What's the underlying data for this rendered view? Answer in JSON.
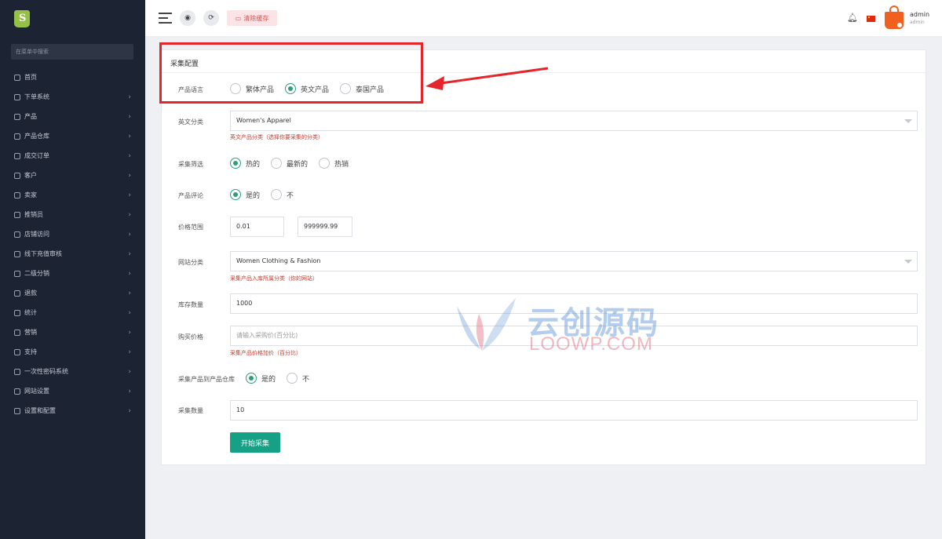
{
  "sidebar": {
    "search_placeholder": "在菜单中搜索",
    "items": [
      {
        "label": "首页",
        "icon": "home-icon",
        "has_arrow": false
      },
      {
        "label": "下单系统",
        "icon": "order-icon",
        "has_arrow": true
      },
      {
        "label": "产品",
        "icon": "cart-icon",
        "has_arrow": true
      },
      {
        "label": "产品仓库",
        "icon": "warehouse-icon",
        "has_arrow": true
      },
      {
        "label": "成交订单",
        "icon": "receipt-icon",
        "has_arrow": true
      },
      {
        "label": "客户",
        "icon": "customer-icon",
        "has_arrow": true
      },
      {
        "label": "卖家",
        "icon": "seller-icon",
        "has_arrow": true
      },
      {
        "label": "推销员",
        "icon": "salesman-icon",
        "has_arrow": true
      },
      {
        "label": "店铺访问",
        "icon": "visit-icon",
        "has_arrow": true
      },
      {
        "label": "线下充值审核",
        "icon": "recharge-icon",
        "has_arrow": true
      },
      {
        "label": "二级分销",
        "icon": "distribution-icon",
        "has_arrow": true
      },
      {
        "label": "退款",
        "icon": "refund-icon",
        "has_arrow": true
      },
      {
        "label": "统计",
        "icon": "stats-icon",
        "has_arrow": true
      },
      {
        "label": "营销",
        "icon": "marketing-icon",
        "has_arrow": true
      },
      {
        "label": "支持",
        "icon": "support-icon",
        "has_arrow": true
      },
      {
        "label": "一次性密码系统",
        "icon": "phone-icon",
        "has_arrow": true
      },
      {
        "label": "网站设置",
        "icon": "monitor-icon",
        "has_arrow": true
      },
      {
        "label": "设置和配置",
        "icon": "settings-icon",
        "has_arrow": true
      }
    ]
  },
  "header": {
    "clear_cache": "清除缓存",
    "user_name": "admin",
    "user_role": "admin"
  },
  "form": {
    "title": "采集配置",
    "language": {
      "label": "产品语言",
      "options": [
        "繁体产品",
        "英文产品",
        "泰国产品"
      ],
      "selected": 1
    },
    "english_category": {
      "label": "英文分类",
      "value": "Women's Apparel",
      "hint": "英文产品分类（选择你要采集的分类）"
    },
    "filter": {
      "label": "采集筛选",
      "options": [
        "热的",
        "最新的",
        "热销"
      ],
      "selected": 0
    },
    "review": {
      "label": "产品评论",
      "options": [
        "是的",
        "不"
      ],
      "selected": 0
    },
    "price_range": {
      "label": "价格范围",
      "min": "0.01",
      "max": "999999.99"
    },
    "site_category": {
      "label": "网站分类",
      "value": "Women Clothing & Fashion",
      "hint": "采集产品入库所属分类（你的网站）"
    },
    "stock": {
      "label": "库存数量",
      "value": "1000"
    },
    "purchase_price": {
      "label": "购买价格",
      "placeholder": "请输入采购价(百分比)",
      "hint": "采集产品价格加价（百分比）"
    },
    "to_warehouse": {
      "label": "采集产品到产品仓库",
      "options": [
        "是的",
        "不"
      ],
      "selected": 0
    },
    "quantity": {
      "label": "采集数量",
      "value": "10"
    },
    "submit": "开始采集"
  },
  "watermark": {
    "title": "云创源码",
    "subtitle": "LOOWP.COM"
  },
  "colors": {
    "sidebar_bg": "#1c2434",
    "accent_green": "#16a085",
    "annotation_red": "#e4252b",
    "hint_red": "#c0392b"
  }
}
